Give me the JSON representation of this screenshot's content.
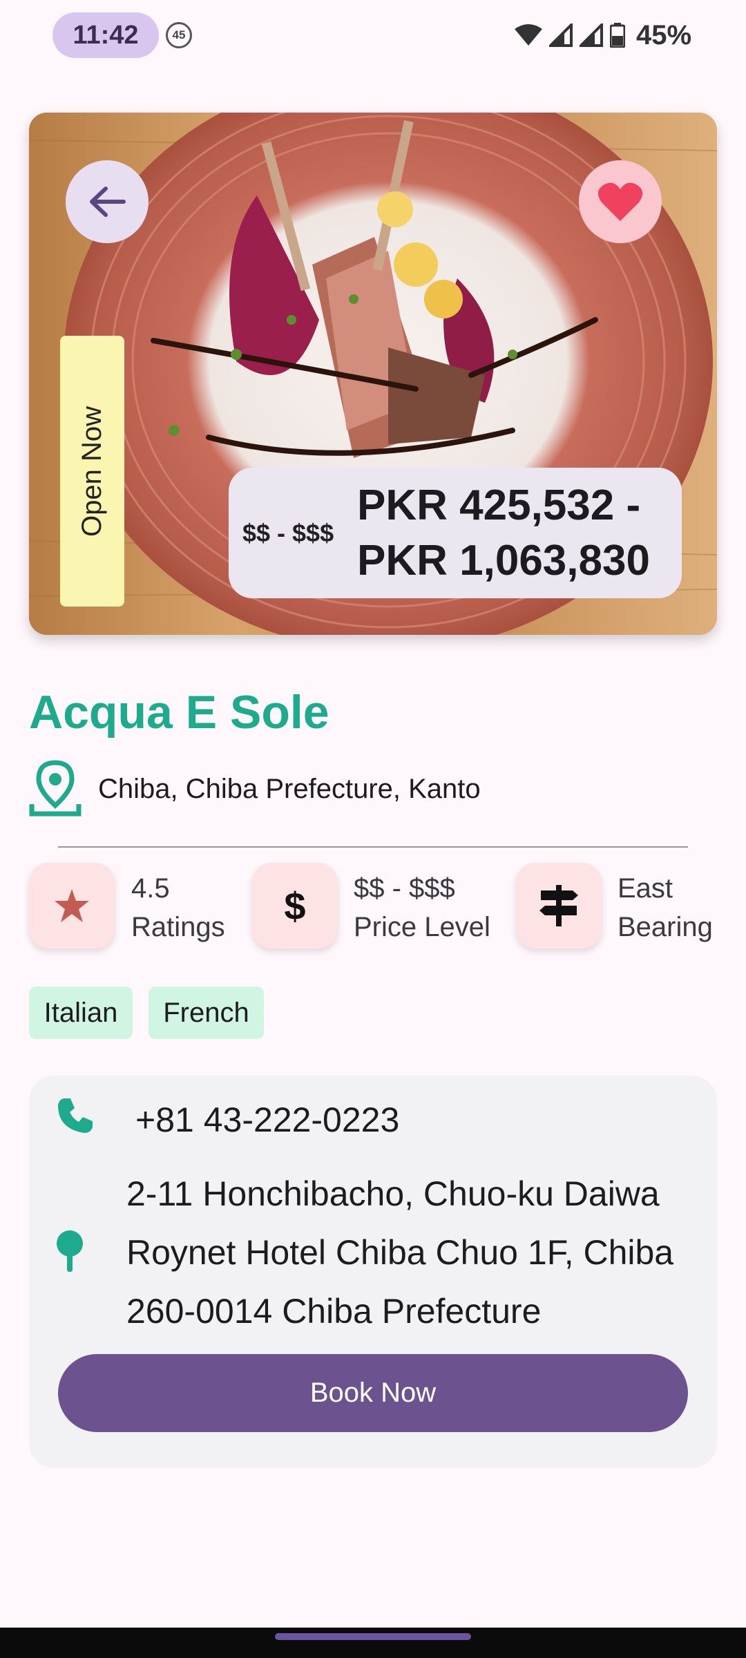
{
  "status_bar": {
    "time": "11:42",
    "notification_count": "45",
    "battery": "45%"
  },
  "hero": {
    "image_alt": "plate of lamb chops with balsamic drizzle",
    "open_status": "Open Now",
    "price_level": "$$ - $$$",
    "price_range_line1": "PKR 425,532 -",
    "price_range_line2": "PKR 1,063,830"
  },
  "restaurant": {
    "name": "Acqua E Sole",
    "location": "Chiba, Chiba Prefecture, Kanto"
  },
  "info": {
    "rating_value": "4.5",
    "rating_label": "Ratings",
    "price_value": "$$ - $$$",
    "price_label": "Price Level",
    "bearing_value": "East",
    "bearing_label": "Bearing",
    "price_icon_glyph": "$"
  },
  "tags": [
    "Italian",
    "French"
  ],
  "contact": {
    "phone": "+81 43-222-0223",
    "address": "2-11 Honchibacho, Chuo-ku Daiwa Roynet Hotel Chiba Chuo 1F, Chiba 260-0014 Chiba Prefecture",
    "book_label": "Book Now"
  },
  "colors": {
    "accent_green": "#1eaa8c",
    "primary_purple": "#6c5390",
    "favorite_red": "#f0425e",
    "tile_pink": "#fde3e3",
    "tag_green": "#d0f5e3"
  },
  "icons": {
    "back": "arrow-left-icon",
    "favorite": "heart-icon",
    "location": "map-pin-icon",
    "rating": "star-icon",
    "price": "dollar-icon",
    "bearing": "signpost-icon",
    "phone": "phone-icon",
    "address": "pin-icon"
  }
}
